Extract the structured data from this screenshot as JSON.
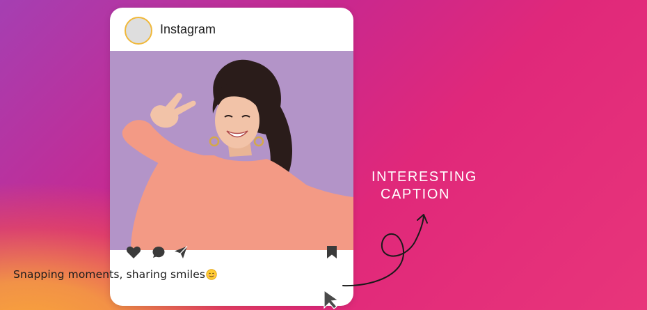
{
  "post": {
    "username": "Instagram",
    "caption": "Snapping moments, sharing smiles"
  },
  "actions": {
    "like_icon": "heart-icon",
    "comment_icon": "comment-icon",
    "share_icon": "send-icon",
    "save_icon": "bookmark-icon"
  },
  "annotation": {
    "line1": "INTERESTING",
    "line2": "CAPTION"
  },
  "colors": {
    "avatar_ring": "#f0b83a",
    "photo_background": "#b394c8",
    "sweater": "#f39a85"
  }
}
